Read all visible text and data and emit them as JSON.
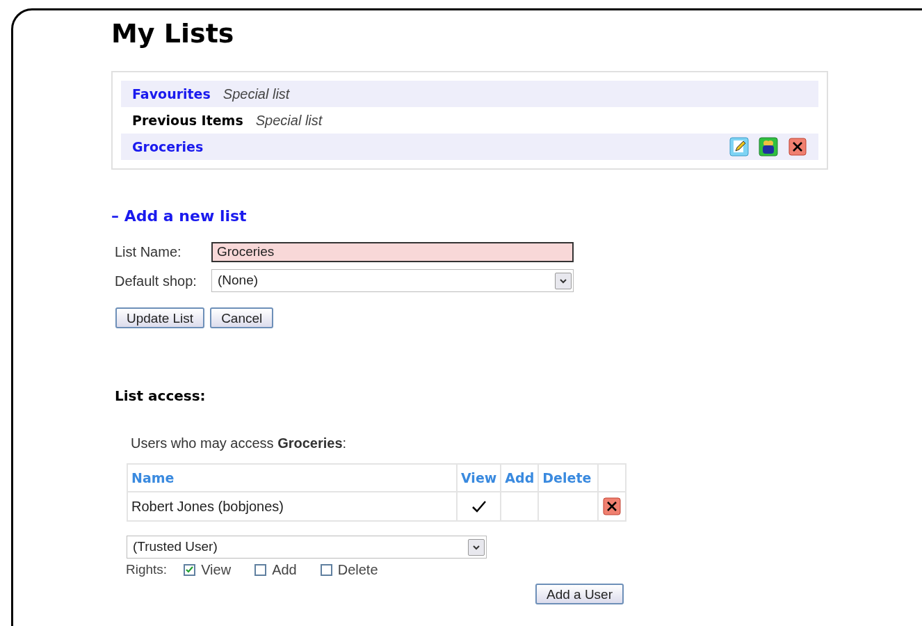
{
  "page_title": "My Lists",
  "lists": [
    {
      "name": "Favourites",
      "note": "Special list",
      "link": true,
      "actions": false
    },
    {
      "name": "Previous Items",
      "note": "Special list",
      "link": false,
      "actions": false
    },
    {
      "name": "Groceries",
      "link": true,
      "actions": true
    }
  ],
  "add_list": {
    "toggle": "– Add a new list",
    "fields": [
      {
        "label": "List Name:",
        "kind": "text",
        "value": "Groceries",
        "invalid": true
      },
      {
        "label": "Default shop:",
        "kind": "select",
        "value": "(None)"
      }
    ],
    "buttons": [
      "Update List",
      "Cancel"
    ]
  },
  "access": {
    "heading": "List access:",
    "intro": "Users who may access **Groceries**:",
    "columns": [
      "Name",
      "View",
      "Add",
      "Delete"
    ],
    "rows": [
      {
        "name": "Robert Jones (bobjones)",
        "view": true,
        "add": false,
        "delete": false
      }
    ],
    "user_select": "(Trusted User)",
    "rights_label": "Rights:",
    "rights": [
      {
        "label": "View",
        "checked": true
      },
      {
        "label": "Add",
        "checked": false
      },
      {
        "label": "Delete",
        "checked": false
      }
    ],
    "add_button": "Add a User"
  }
}
